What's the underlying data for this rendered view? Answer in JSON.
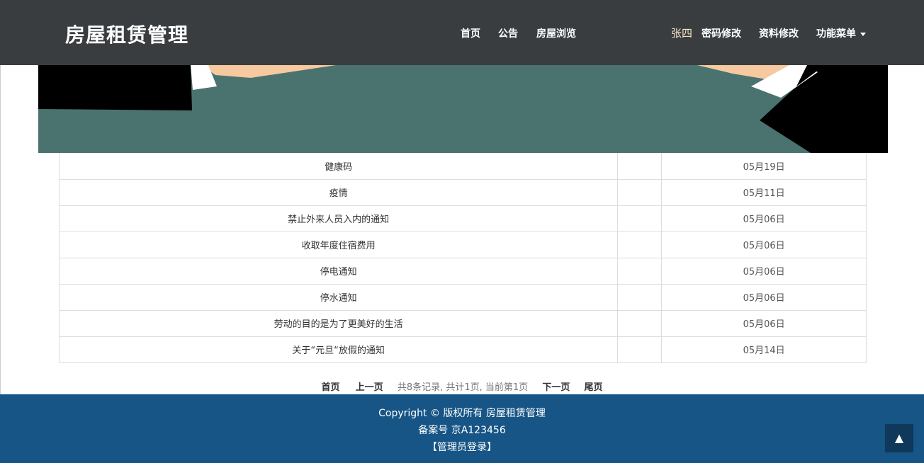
{
  "header": {
    "brand": "房屋租赁管理",
    "nav": [
      "首页",
      "公告",
      "房屋浏览"
    ],
    "user_name": "张四",
    "user_links": [
      "密码修改",
      "资料修改",
      "功能菜单"
    ]
  },
  "notices": [
    {
      "title": "健康码",
      "date": "05月19日"
    },
    {
      "title": "疫情",
      "date": "05月11日"
    },
    {
      "title": "禁止外来人员入内的通知",
      "date": "05月06日"
    },
    {
      "title": "收取年度住宿费用",
      "date": "05月06日"
    },
    {
      "title": "停电通知",
      "date": "05月06日"
    },
    {
      "title": "停水通知",
      "date": "05月06日"
    },
    {
      "title": "劳动的目的是为了更美好的生活",
      "date": "05月06日"
    },
    {
      "title": "关于“元旦“放假的通知",
      "date": "05月14日"
    }
  ],
  "pager": {
    "first": "首页",
    "prev": "上一页",
    "info": "共8条记录, 共计1页, 当前第1页",
    "next": "下一页",
    "last": "尾页"
  },
  "footer": {
    "copyright": "Copyright © 版权所有 房屋租赁管理",
    "icp": "备案号 京A123456",
    "admin_login": "【管理员登录】"
  },
  "back_to_top": {
    "icon": "triangle-up-icon",
    "glyph": "▲"
  },
  "colors": {
    "navbar": "#393d40",
    "footer": "#165585",
    "banner_green": "#4a736f",
    "user_name": "#f3e4c0"
  }
}
